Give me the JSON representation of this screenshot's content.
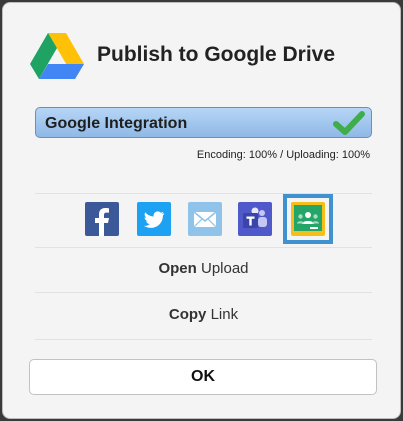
{
  "dialog": {
    "title": "Publish to Google Drive",
    "progress_label": "Google Integration",
    "status_text": "Encoding: 100% / Uploading: 100%",
    "share_targets": [
      {
        "name": "Facebook",
        "icon": "facebook-icon",
        "color": "#3b5998"
      },
      {
        "name": "Twitter",
        "icon": "twitter-icon",
        "color": "#1da1f2"
      },
      {
        "name": "Email",
        "icon": "email-icon",
        "color": "#8fc3ea"
      },
      {
        "name": "Microsoft Teams",
        "icon": "teams-icon",
        "color": "#5059c9"
      },
      {
        "name": "Google Classroom",
        "icon": "google-classroom-icon",
        "color": "#25a667",
        "selected": true
      }
    ],
    "open_action": {
      "verb": "Open",
      "object": "Upload"
    },
    "copy_action": {
      "verb": "Copy",
      "object": "Link"
    },
    "ok_label": "OK"
  },
  "colors": {
    "progress_fill": "#9fc6ef",
    "selection_outline": "#3f91d0",
    "check_green": "#3fae49"
  }
}
